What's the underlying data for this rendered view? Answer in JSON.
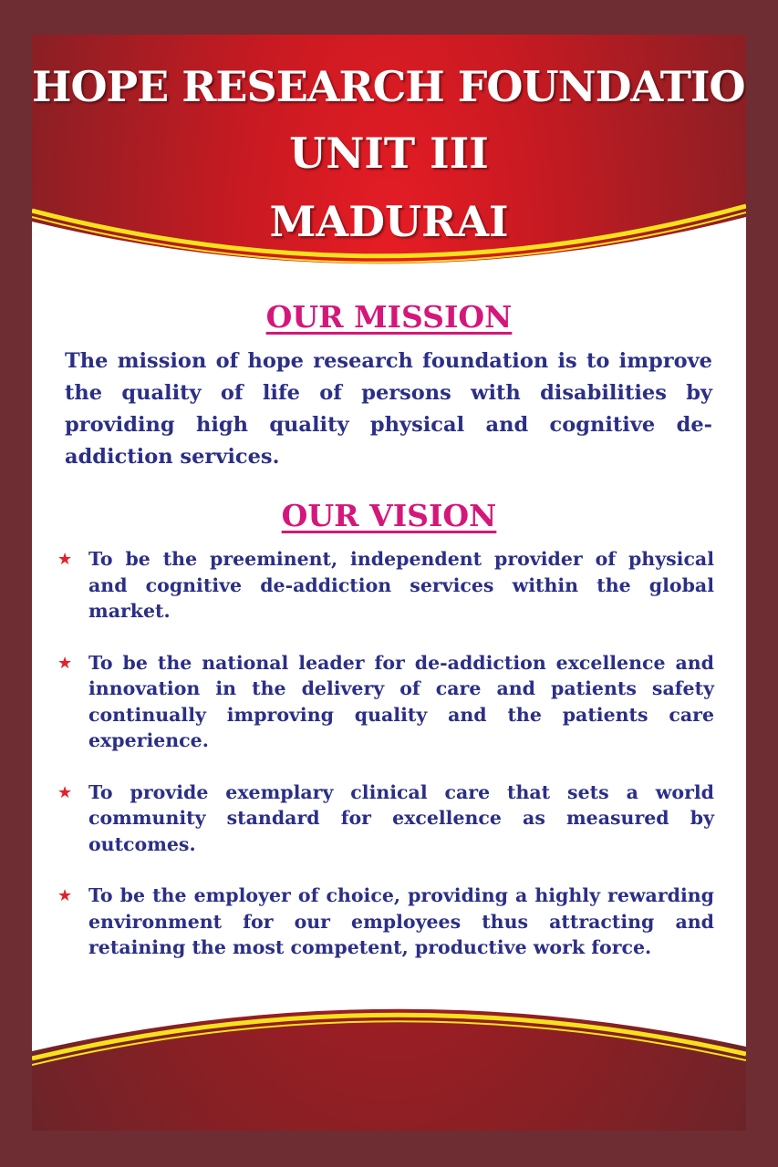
{
  "header": {
    "line1": "HOPE RESEARCH FOUNDATION",
    "line2": "UNIT III",
    "line3": "MADURAI"
  },
  "mission": {
    "heading": "OUR MISSION",
    "text": "The mission of hope research foundation is to improve the quality of life of persons with disabilities by providing high quality physical and cognitive de-addiction services."
  },
  "vision": {
    "heading": "OUR VISION",
    "bullet_icon": "star-icon",
    "items": [
      {
        "text": "To be the preeminent, independent provider of physical and cognitive de-addiction services within the global market."
      },
      {
        "text": "To be the national leader for de-addiction excellence and innovation in the delivery of care and patients safety continually improving quality and the patients care experience."
      },
      {
        "text": "To provide exemplary clinical care that sets a world community standard for excellence as measured by outcomes."
      },
      {
        "text": "To be the employer of choice, providing a highly rewarding environment for our employees thus attracting and retaining the most competent, productive work force."
      }
    ]
  },
  "colors": {
    "border": "#6e2d32",
    "banner_red": "#e81c24",
    "swoosh_yellow": "#f5e21b",
    "heading_pink": "#d4177a",
    "body_navy": "#2b2f86",
    "bullet_red": "#e4202a"
  }
}
